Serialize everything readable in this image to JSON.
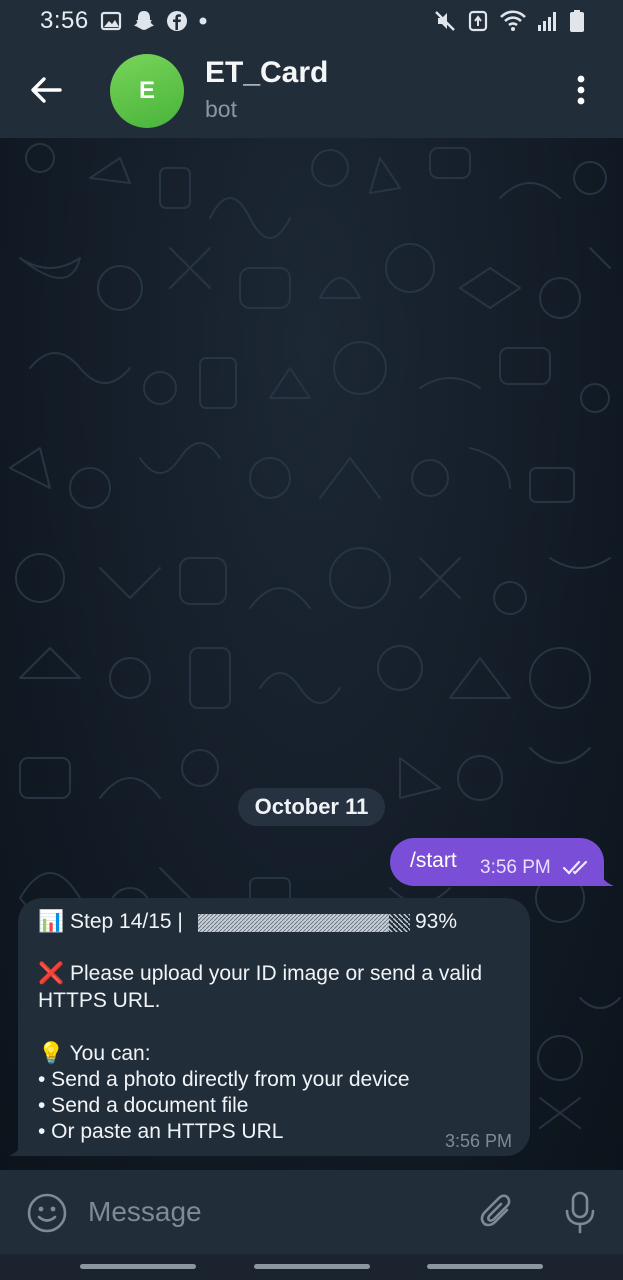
{
  "status_bar": {
    "time": "3:56",
    "left_icons": [
      "gallery-icon",
      "snapchat-icon",
      "facebook-icon",
      "dot-icon"
    ],
    "right_icons": [
      "mute-icon",
      "data-saver-icon",
      "wifi-icon",
      "signal-icon",
      "battery-icon"
    ]
  },
  "header": {
    "avatar_letter": "E",
    "title": "ET_Card",
    "subtitle": "bot",
    "avatar_color": "#5cc64a"
  },
  "chat": {
    "date_chip": "October 11",
    "outgoing": {
      "text": "/start",
      "time": "3:56 PM",
      "status": "read",
      "bubble_color": "#7a4ed6"
    },
    "incoming": {
      "line_step_prefix": "📊 Step 14/15 |",
      "progress_percent": "93%",
      "progress_fraction": 0.93,
      "line_error": "❌ Please upload your ID image or send a valid",
      "line_error_cont": "HTTPS URL.",
      "line_tip": "💡 You can:",
      "bullets": [
        "• Send a photo directly from your device",
        "• Send a document file",
        "• Or paste an HTTPS URL"
      ],
      "time": "3:56 PM"
    }
  },
  "composer": {
    "placeholder": "Message"
  },
  "colors": {
    "background": "#0e1621",
    "header": "#222d3a",
    "incoming_bubble": "#222d3a",
    "outgoing_bubble": "#7a4ed6"
  }
}
